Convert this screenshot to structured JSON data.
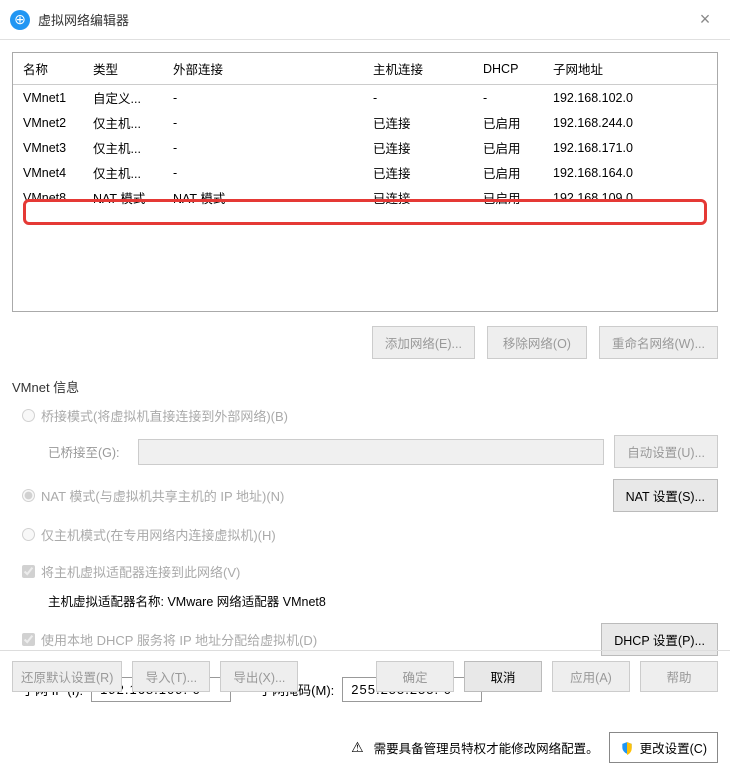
{
  "window": {
    "title": "虚拟网络编辑器"
  },
  "table": {
    "headers": [
      "名称",
      "类型",
      "外部连接",
      "主机连接",
      "DHCP",
      "子网地址"
    ],
    "rows": [
      {
        "name": "VMnet1",
        "type": "自定义...",
        "ext": "-",
        "host": "-",
        "dhcp": "-",
        "subnet": "192.168.102.0"
      },
      {
        "name": "VMnet2",
        "type": "仅主机...",
        "ext": "-",
        "host": "已连接",
        "dhcp": "已启用",
        "subnet": "192.168.244.0"
      },
      {
        "name": "VMnet3",
        "type": "仅主机...",
        "ext": "-",
        "host": "已连接",
        "dhcp": "已启用",
        "subnet": "192.168.171.0"
      },
      {
        "name": "VMnet4",
        "type": "仅主机...",
        "ext": "-",
        "host": "已连接",
        "dhcp": "已启用",
        "subnet": "192.168.164.0"
      },
      {
        "name": "VMnet8",
        "type": "NAT 模式",
        "ext": "NAT 模式",
        "host": "已连接",
        "dhcp": "已启用",
        "subnet": "192.168.109.0"
      }
    ]
  },
  "buttons": {
    "add": "添加网络(E)...",
    "remove": "移除网络(O)",
    "rename": "重命名网络(W)...",
    "auto": "自动设置(U)...",
    "nat": "NAT 设置(S)...",
    "dhcp": "DHCP 设置(P)...",
    "change": "更改设置(C)",
    "restore": "还原默认设置(R)",
    "import": "导入(T)...",
    "export": "导出(X)...",
    "ok": "确定",
    "cancel": "取消",
    "apply": "应用(A)",
    "help": "帮助"
  },
  "info": {
    "title": "VMnet 信息",
    "bridge": "桥接模式(将虚拟机直接连接到外部网络)(B)",
    "bridgeTo": "已桥接至(G):",
    "nat": "NAT 模式(与虚拟机共享主机的 IP 地址)(N)",
    "hostonly": "仅主机模式(在专用网络内连接虚拟机)(H)",
    "hostAdapter": "将主机虚拟适配器连接到此网络(V)",
    "adapterName": "主机虚拟适配器名称: VMware 网络适配器 VMnet8",
    "useDhcp": "使用本地 DHCP 服务将 IP 地址分配给虚拟机(D)",
    "subnetIp": "子网 IP (I):",
    "subnetIpVal": "192.168.109. 0",
    "subnetMask": "子网掩码(M):",
    "subnetMaskVal": "255.255.255. 0",
    "warn": "需要具备管理员特权才能修改网络配置。"
  }
}
